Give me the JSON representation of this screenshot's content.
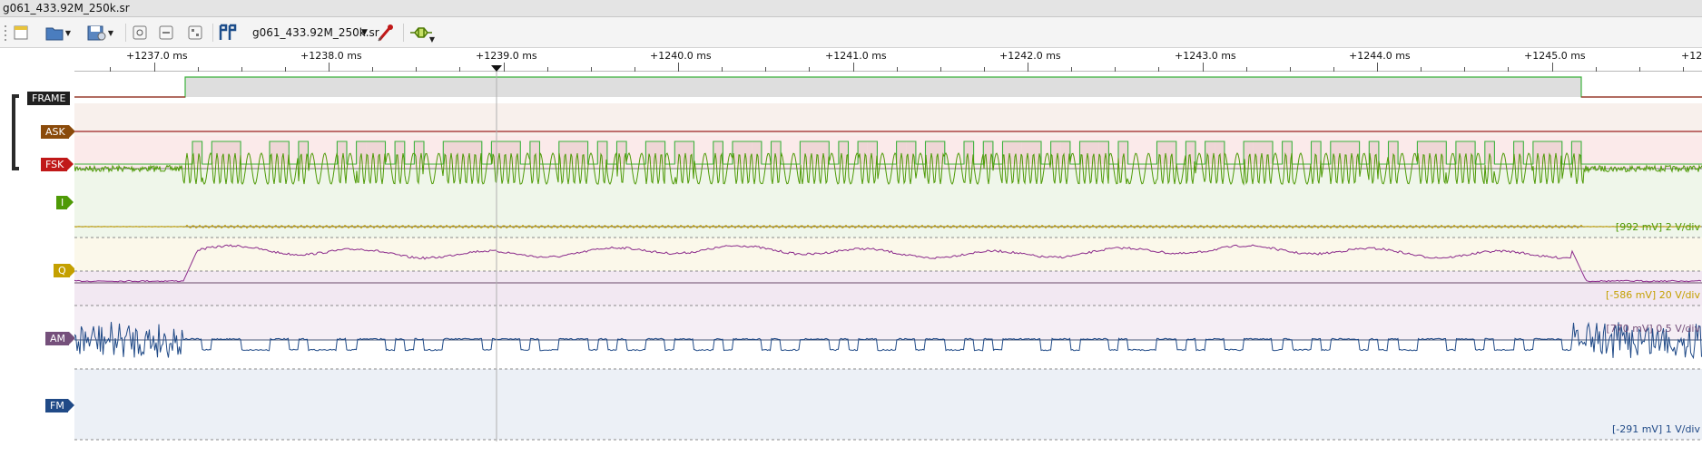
{
  "window": {
    "title": "g061_433.92M_250k.sr"
  },
  "toolbar": {
    "file_name": "g061_433.92M_250k.sr",
    "icons": [
      "new-session-icon",
      "open-file-icon",
      "save-file-icon",
      "zoom-fit-icon",
      "zoom-one-to-one-icon",
      "zoom-in-icon",
      "cursor-icon",
      "device-select-icon",
      "probe-icon",
      "decoder-icon"
    ]
  },
  "ruler": {
    "labels": [
      "+1237.0 ms",
      "+1238.0 ms",
      "+1239.0 ms",
      "+1240.0 ms",
      "+1241.0 ms",
      "+1242.0 ms",
      "+1243.0 ms",
      "+1244.0 ms",
      "+1245.0 ms",
      "+12"
    ]
  },
  "channels": {
    "frame": {
      "name": "FRAME",
      "color": "#202020"
    },
    "ask": {
      "name": "ASK",
      "color": "#8a4a0a"
    },
    "fsk": {
      "name": "FSK",
      "color": "#c01818"
    },
    "i": {
      "name": "I",
      "color": "#4e9a06",
      "scale": "[992 mV] 2 V/div"
    },
    "q": {
      "name": "Q",
      "color": "#c4a000",
      "scale": "[-586 mV] 20 V/div"
    },
    "am": {
      "name": "AM",
      "color": "#75507b",
      "scale": "[770 mV] 0.5 V/div"
    },
    "fm": {
      "name": "FM",
      "color": "#204a87",
      "scale": "[-291 mV] 1 V/div"
    }
  },
  "colors": {
    "logic_high": "#3cb23c",
    "logic_low": "#a02020",
    "analog_i": "#4e9a06",
    "analog_q": "#c4a000",
    "analog_am": "#8b2a8b",
    "analog_fm": "#204a87",
    "cursor": "#b0b0b0"
  },
  "signal": {
    "fsk_bits": "101110001101000101110101001111011101001110101001101100101110100111010110011011001010111101101110100011010110011101001011101010011101101001011101"
  }
}
